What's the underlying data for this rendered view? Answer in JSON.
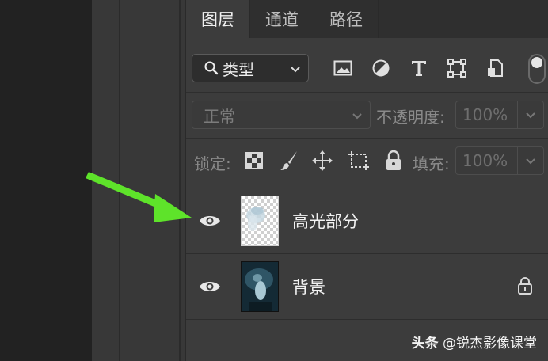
{
  "tabs": [
    {
      "label": "图层"
    },
    {
      "label": "通道"
    },
    {
      "label": "路径"
    }
  ],
  "filter": {
    "label": "类型",
    "icons": [
      "image-filter-icon",
      "adjustment-filter-icon",
      "type-filter-icon",
      "shape-filter-icon",
      "smart-object-filter-icon"
    ]
  },
  "blend": {
    "mode": "正常",
    "opacity_label": "不透明度:",
    "opacity_value": "100%"
  },
  "lock": {
    "label": "锁定:",
    "fill_label": "填充:",
    "fill_value": "100%",
    "icons": [
      "lock-transparent-pixels-icon",
      "lock-image-pixels-icon",
      "lock-position-icon",
      "lock-artboard-icon",
      "lock-all-icon"
    ]
  },
  "layers": [
    {
      "name": "高光部分",
      "thumbnail": "transparent-checker",
      "visible": true
    },
    {
      "name": "背景",
      "thumbnail": "photo",
      "visible": true,
      "locked": true
    }
  ],
  "watermark": {
    "brand": "头条",
    "handle": "@锐杰影像课堂"
  },
  "colors": {
    "panel": "#3c3c3c",
    "tabs_bg": "#2f2f2f",
    "arrow": "#5ee32a"
  }
}
